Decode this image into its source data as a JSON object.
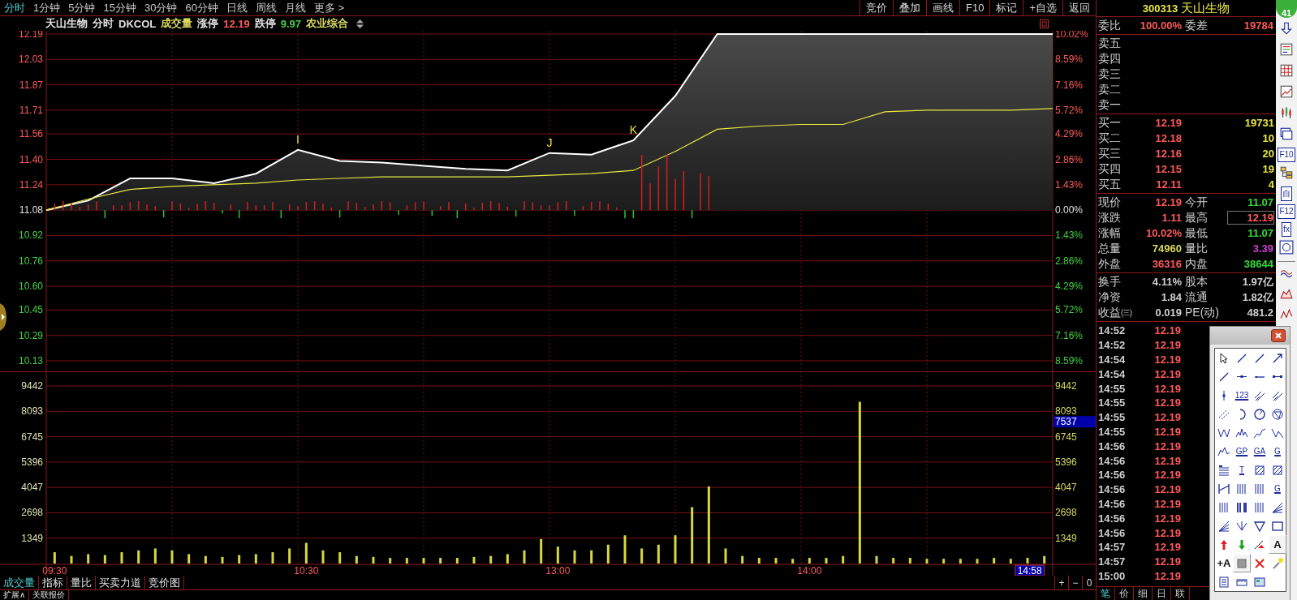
{
  "top_menu": {
    "periods": [
      {
        "label": "分时",
        "selected": true
      },
      {
        "label": "1分钟",
        "selected": false
      },
      {
        "label": "5分钟",
        "selected": false
      },
      {
        "label": "15分钟",
        "selected": false
      },
      {
        "label": "30分钟",
        "selected": false
      },
      {
        "label": "60分钟",
        "selected": false
      },
      {
        "label": "日线",
        "selected": false
      },
      {
        "label": "周线",
        "selected": false
      },
      {
        "label": "月线",
        "selected": false
      },
      {
        "label": "更多 >",
        "selected": false
      }
    ],
    "buttons": [
      "竞价",
      "叠加",
      "画线",
      "F10",
      "标记",
      "+自选",
      "返回"
    ]
  },
  "chart_header": {
    "items": [
      {
        "text": "天山生物",
        "color": "#e0e0e0"
      },
      {
        "text": "分时",
        "color": "#e0e0e0"
      },
      {
        "text": "DKCOL",
        "color": "#e0e0e0"
      },
      {
        "text": "成交量",
        "color": "#d8d860"
      },
      {
        "text": "涨停",
        "color": "#e0e0e0"
      },
      {
        "text": "12.19",
        "color": "#ff5a5a"
      },
      {
        "text": "跌停",
        "color": "#e0e0e0"
      },
      {
        "text": "9.97",
        "color": "#44d044"
      },
      {
        "text": "农业综合",
        "color": "#d8d860"
      }
    ]
  },
  "price_chart": {
    "chart_data": {
      "type": "area",
      "grid": true,
      "categories": [
        null,
        null,
        null,
        null,
        null,
        null,
        null,
        null,
        null,
        null,
        null,
        null,
        null,
        null,
        null,
        null,
        null,
        null,
        null,
        null,
        null,
        null,
        null,
        null,
        null
      ],
      "series": [
        {
          "color": "#ffffff",
          "values": [
            11.08,
            11.14,
            11.28,
            11.28,
            11.25,
            11.31,
            11.46,
            11.39,
            11.38,
            11.36,
            11.34,
            11.33,
            11.44,
            11.43,
            11.52,
            11.8,
            12.19,
            12.19,
            12.19,
            12.19,
            12.19,
            12.19,
            12.19,
            12.19,
            12.19
          ]
        },
        {
          "type": "line",
          "color": "#e8e840",
          "values": [
            11.08,
            11.15,
            11.21,
            11.23,
            11.24,
            11.25,
            11.27,
            11.28,
            11.29,
            11.29,
            11.29,
            11.29,
            11.3,
            11.31,
            11.33,
            11.45,
            11.59,
            11.61,
            11.62,
            11.62,
            11.7,
            11.71,
            11.71,
            11.71,
            11.72
          ]
        }
      ],
      "ylim": [
        10.13,
        12.19
      ],
      "yticks": [
        {
          "value": 12.19,
          "label": "12.19"
        },
        {
          "value": 12.03,
          "label": "12.03"
        },
        {
          "value": 11.87,
          "label": "11.87"
        },
        {
          "value": 11.71,
          "label": "11.71"
        },
        {
          "value": 11.56,
          "label": "11.56"
        },
        {
          "value": 11.4,
          "label": "11.40"
        },
        {
          "value": 11.24,
          "label": "11.24"
        },
        {
          "value": 11.08,
          "label": "11.08"
        },
        {
          "value": 10.92,
          "label": "10.92"
        },
        {
          "value": 10.76,
          "label": "10.76"
        },
        {
          "value": 10.6,
          "label": "10.60"
        },
        {
          "value": 10.45,
          "label": "10.45"
        },
        {
          "value": 10.29,
          "label": "10.29"
        },
        {
          "value": 10.13,
          "label": "10.13"
        }
      ],
      "orientation": "vertical"
    },
    "markers": [
      "I",
      "J",
      "K"
    ],
    "right_axis_labels": [
      {
        "label": "10.02%",
        "color": "#ff5a5a"
      },
      {
        "label": "8.59%",
        "color": "#ff5a5a"
      },
      {
        "label": "7.16%",
        "color": "#ff5a5a"
      },
      {
        "label": "5.72%",
        "color": "#ff5a5a"
      },
      {
        "label": "4.29%",
        "color": "#ff5a5a"
      },
      {
        "label": "2.86%",
        "color": "#ff5a5a"
      },
      {
        "label": "1.43%",
        "color": "#ff5a5a"
      },
      {
        "label": "0.00%",
        "color": "#e0e0e0"
      },
      {
        "label": "1.43%",
        "color": "#44d044"
      },
      {
        "label": "2.86%",
        "color": "#44d044"
      },
      {
        "label": "4.29%",
        "color": "#44d044"
      },
      {
        "label": "5.72%",
        "color": "#44d044"
      },
      {
        "label": "7.16%",
        "color": "#44d044"
      },
      {
        "label": "8.59%",
        "color": "#44d044"
      }
    ]
  },
  "volume_chart": {
    "chart_data": {
      "type": "bar",
      "grid": true,
      "categories": [
        "09:30",
        null,
        null,
        null,
        null,
        null,
        null,
        null,
        null,
        null,
        null,
        null,
        null,
        null,
        null,
        "10:30",
        null,
        null,
        null,
        null,
        null,
        null,
        null,
        null,
        null,
        null,
        null,
        null,
        null,
        null,
        "13:00",
        null,
        null,
        null,
        null,
        null,
        null,
        null,
        null,
        null,
        null,
        null,
        null,
        null,
        null,
        "14:00",
        null,
        null,
        null,
        null,
        null,
        null,
        null,
        null,
        null,
        null,
        null,
        null,
        null,
        null
      ],
      "values": [
        600,
        400,
        500,
        450,
        600,
        700,
        800,
        700,
        500,
        400,
        350,
        450,
        500,
        600,
        800,
        1100,
        700,
        600,
        400,
        350,
        300,
        300,
        300,
        300,
        300,
        350,
        400,
        500,
        700,
        1300,
        900,
        700,
        700,
        1000,
        1500,
        800,
        1000,
        1500,
        3000,
        4100,
        800,
        400,
        300,
        300,
        250,
        300,
        300,
        400,
        8600,
        400,
        300,
        300,
        250,
        250,
        250,
        250,
        300,
        250,
        300,
        400
      ],
      "ylim": [
        0,
        9442
      ],
      "yticks": [
        {
          "value": 9442,
          "label": "9442"
        },
        {
          "value": 8093,
          "label": "8093"
        },
        {
          "value": 6745,
          "label": "6745"
        },
        {
          "value": 5396,
          "label": "5396"
        },
        {
          "value": 4047,
          "label": "4047"
        },
        {
          "value": 2698,
          "label": "2698"
        },
        {
          "value": 1349,
          "label": "1349"
        }
      ],
      "orientation": "vertical"
    },
    "right_axis_labels": [
      "9442",
      "8093",
      "6745",
      "5396",
      "4047",
      "2698",
      "1349"
    ],
    "cursor_value": "7537",
    "cursor_time": "14:58"
  },
  "bottom_tabs": [
    {
      "label": "成交量",
      "selected": true
    },
    {
      "label": "指标",
      "selected": false
    },
    {
      "label": "量比",
      "selected": false
    },
    {
      "label": "买卖力道",
      "selected": false
    },
    {
      "label": "竞价图",
      "selected": false
    }
  ],
  "zoom_buttons": [
    "+",
    "−",
    "0"
  ],
  "bottom_tabs_2": [
    "扩展∧",
    "关联报价"
  ],
  "quote_panel": {
    "code": "300313",
    "name": "天山生物",
    "ratio": {
      "label": "委比",
      "value": "100.00%",
      "label2": "委差",
      "value2": "19784"
    },
    "asks": [
      "卖五",
      "卖四",
      "卖三",
      "卖二",
      "卖一"
    ],
    "bids": [
      {
        "label": "买一",
        "price": "12.19",
        "volume": "19731"
      },
      {
        "label": "买二",
        "price": "12.18",
        "volume": "10"
      },
      {
        "label": "买三",
        "price": "12.16",
        "volume": "20"
      },
      {
        "label": "买四",
        "price": "12.15",
        "volume": "19"
      },
      {
        "label": "买五",
        "price": "12.11",
        "volume": "4"
      }
    ],
    "stats": [
      {
        "label": "现价",
        "value": "12.19",
        "color": "#ff5a5a",
        "highlighted": false
      },
      {
        "label": "今开",
        "value": "11.07",
        "color": "#33dd33",
        "highlighted": false
      },
      {
        "label": "涨跌",
        "value": "1.11",
        "color": "#ff5a5a",
        "highlighted": false
      },
      {
        "label": "最高",
        "value": "12.19",
        "color": "#ff5a5a",
        "highlighted": true
      },
      {
        "label": "涨幅",
        "value": "10.02%",
        "color": "#ff5a5a",
        "highlighted": false
      },
      {
        "label": "最低",
        "value": "11.07",
        "color": "#33dd33",
        "highlighted": false
      },
      {
        "label": "总量",
        "value": "74960",
        "color": "#d8d860",
        "highlighted": false
      },
      {
        "label": "量比",
        "value": "3.39",
        "color": "#d040d0",
        "highlighted": false
      },
      {
        "label": "外盘",
        "value": "36316",
        "color": "#ff5a5a",
        "highlighted": false
      },
      {
        "label": "内盘",
        "value": "38644",
        "color": "#33dd33",
        "highlighted": false
      }
    ],
    "fundamentals": [
      {
        "label": "换手",
        "value": "4.11%",
        "label2": "股本",
        "value2": "1.97亿"
      },
      {
        "label": "净资",
        "value": "1.84",
        "label2": "流通",
        "value2": "1.82亿"
      },
      {
        "label": "收益㈢",
        "value": "0.019",
        "label2": "PE(动)",
        "value2": "481.2"
      }
    ],
    "ticks": [
      {
        "time": "14:52",
        "price": "12.19"
      },
      {
        "time": "14:52",
        "price": "12.19"
      },
      {
        "time": "14:54",
        "price": "12.19"
      },
      {
        "time": "14:54",
        "price": "12.19"
      },
      {
        "time": "14:55",
        "price": "12.19"
      },
      {
        "time": "14:55",
        "price": "12.19"
      },
      {
        "time": "14:55",
        "price": "12.19"
      },
      {
        "time": "14:55",
        "price": "12.19"
      },
      {
        "time": "14:56",
        "price": "12.19"
      },
      {
        "time": "14:56",
        "price": "12.19"
      },
      {
        "time": "14:56",
        "price": "12.19"
      },
      {
        "time": "14:56",
        "price": "12.19"
      },
      {
        "time": "14:56",
        "price": "12.19"
      },
      {
        "time": "14:56",
        "price": "12.19"
      },
      {
        "time": "14:56",
        "price": "12.19"
      },
      {
        "time": "14:57",
        "price": "12.19"
      },
      {
        "time": "14:57",
        "price": "12.19"
      },
      {
        "time": "15:00",
        "price": "12.19"
      }
    ],
    "tabs": [
      {
        "label": "笔",
        "selected": true
      },
      {
        "label": "价",
        "selected": false
      },
      {
        "label": "细",
        "selected": false
      },
      {
        "label": "日",
        "selected": false
      },
      {
        "label": "联",
        "selected": false
      }
    ]
  },
  "side_toolbar": {
    "badge": "41",
    "items": [
      {
        "kind": "down-arrow"
      },
      {
        "kind": "checklist"
      },
      {
        "kind": "grid"
      },
      {
        "kind": "line-chart"
      },
      {
        "kind": "candles"
      },
      {
        "kind": "windows"
      },
      {
        "kind": "label",
        "label": "F10"
      },
      {
        "kind": "tree"
      },
      {
        "kind": "label",
        "label": "自"
      },
      {
        "kind": "label",
        "label": "F12"
      },
      {
        "kind": "label",
        "label": "fx"
      },
      {
        "kind": "circle"
      },
      {
        "kind": "separator"
      },
      {
        "kind": "wave"
      },
      {
        "kind": "mountain"
      },
      {
        "kind": "zigzag"
      }
    ]
  },
  "drawing_toolbox": {
    "tools": [
      {
        "kind": "cursor",
        "selected": false
      },
      {
        "kind": "segment",
        "selected": false
      },
      {
        "kind": "segment",
        "selected": false
      },
      {
        "kind": "arrow-line",
        "selected": false
      },
      {
        "kind": "segment",
        "selected": false
      },
      {
        "kind": "dot-line",
        "selected": false
      },
      {
        "kind": "hline",
        "selected": false
      },
      {
        "kind": "hline-ends",
        "selected": false
      },
      {
        "kind": "vline",
        "selected": false
      },
      {
        "kind": "labeled",
        "label": "123",
        "selected": false
      },
      {
        "kind": "parallel",
        "selected": false
      },
      {
        "kind": "parallel",
        "selected": false
      },
      {
        "kind": "dash-parallel",
        "selected": false
      },
      {
        "kind": "arc",
        "selected": false
      },
      {
        "kind": "circle",
        "selected": false
      },
      {
        "kind": "polygon-circle",
        "selected": false
      },
      {
        "kind": "wave-w",
        "selected": false
      },
      {
        "kind": "wave-m",
        "selected": false
      },
      {
        "kind": "wave-up",
        "selected": false
      },
      {
        "kind": "wave-n",
        "selected": false
      },
      {
        "kind": "peaks",
        "selected": false
      },
      {
        "kind": "labeled",
        "label": "GP",
        "selected": false
      },
      {
        "kind": "labeled",
        "label": "GA",
        "selected": false
      },
      {
        "kind": "labeled",
        "label": "G",
        "selected": false
      },
      {
        "kind": "lines-list",
        "selected": false
      },
      {
        "kind": "labeled",
        "label": "T",
        "selected": false
      },
      {
        "kind": "hatch",
        "selected": false
      },
      {
        "kind": "hatch",
        "selected": false
      },
      {
        "kind": "bracket",
        "selected": false
      },
      {
        "kind": "vbars",
        "selected": false
      },
      {
        "kind": "vbars",
        "selected": false
      },
      {
        "kind": "labeled",
        "label": "G",
        "selected": false
      },
      {
        "kind": "vbars",
        "selected": false
      },
      {
        "kind": "vbars-bold",
        "selected": false
      },
      {
        "kind": "vbars",
        "selected": false
      },
      {
        "kind": "fan",
        "selected": false
      },
      {
        "kind": "fan",
        "selected": false
      },
      {
        "kind": "down-v",
        "selected": false
      },
      {
        "kind": "triangle",
        "selected": false
      },
      {
        "kind": "rect",
        "selected": false
      },
      {
        "kind": "up-arrow",
        "selected": false
      },
      {
        "kind": "down-arrow",
        "selected": false
      },
      {
        "kind": "arrow-up-line",
        "selected": false
      },
      {
        "kind": "letter",
        "label": "A",
        "selected": true
      },
      {
        "kind": "letter",
        "label": "+A",
        "selected": false
      },
      {
        "kind": "square",
        "selected": true
      },
      {
        "kind": "cross",
        "selected": false
      },
      {
        "kind": "brush",
        "selected": false
      },
      {
        "kind": "doc",
        "selected": false
      },
      {
        "kind": "ruler",
        "selected": false
      },
      {
        "kind": "image",
        "selected": false
      }
    ]
  }
}
